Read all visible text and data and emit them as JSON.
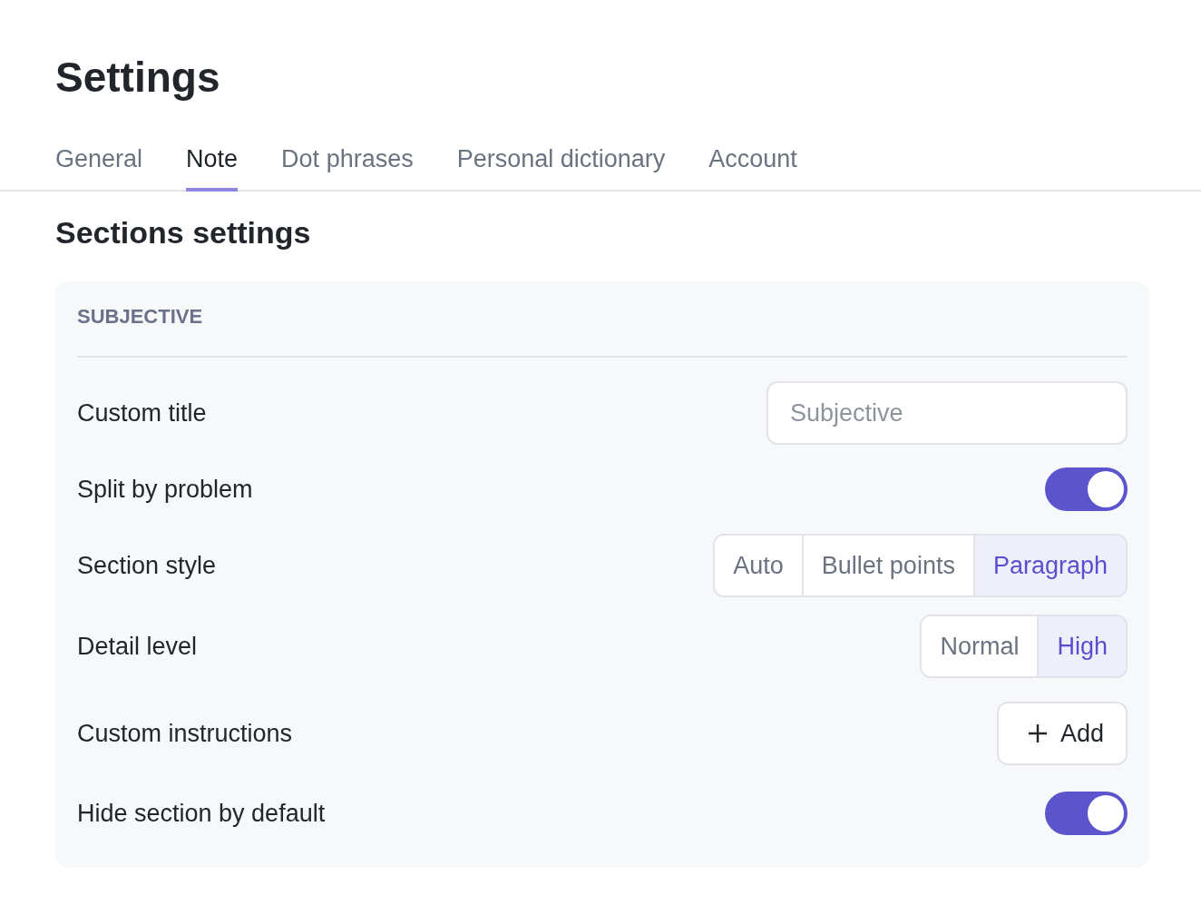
{
  "page": {
    "title": "Settings"
  },
  "tabs": [
    {
      "label": "General",
      "selected": false
    },
    {
      "label": "Note",
      "selected": true
    },
    {
      "label": "Dot phrases",
      "selected": false
    },
    {
      "label": "Personal dictionary",
      "selected": false
    },
    {
      "label": "Account",
      "selected": false
    }
  ],
  "section_heading": "Sections settings",
  "card": {
    "title": "SUBJECTIVE",
    "rows": [
      {
        "kind": "input",
        "label": "Custom title",
        "placeholder": "Subjective"
      },
      {
        "kind": "toggle",
        "label": "Split by problem",
        "on": true
      },
      {
        "kind": "segmented",
        "label": "Section style",
        "options": [
          {
            "label": "Auto",
            "selected": false
          },
          {
            "label": "Bullet points",
            "selected": false
          },
          {
            "label": "Paragraph",
            "selected": true
          }
        ]
      },
      {
        "kind": "segmented",
        "label": "Detail level",
        "options": [
          {
            "label": "Normal",
            "selected": false
          },
          {
            "label": "High",
            "selected": true
          }
        ]
      },
      {
        "kind": "button",
        "label": "Custom instructions",
        "button": "Add"
      },
      {
        "kind": "toggle",
        "label": "Hide section by default",
        "on": true
      }
    ]
  }
}
